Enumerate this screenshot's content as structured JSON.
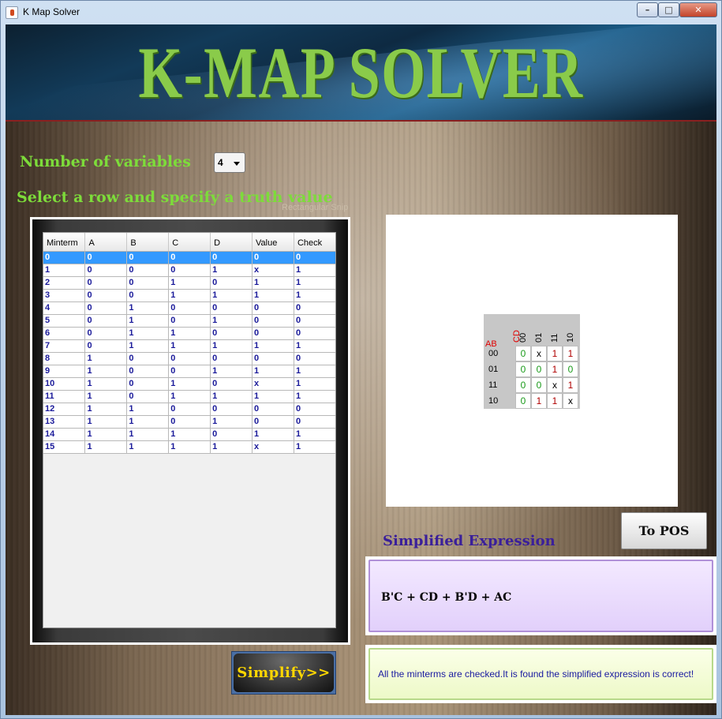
{
  "window": {
    "title": "K Map Solver"
  },
  "banner": {
    "title": "K-MAP SOLVER"
  },
  "controls": {
    "num_vars_label": "Number of variables",
    "num_vars_value": "4",
    "select_row_label": "Select a row and specify a truth value",
    "snip_text": "Rectangular Snip"
  },
  "table": {
    "columns": [
      "Minterm",
      "A",
      "B",
      "C",
      "D",
      "Value",
      "Check"
    ],
    "selected_row": 0,
    "rows": [
      [
        "0",
        "0",
        "0",
        "0",
        "0",
        "0",
        "0"
      ],
      [
        "1",
        "0",
        "0",
        "0",
        "1",
        "x",
        "1"
      ],
      [
        "2",
        "0",
        "0",
        "1",
        "0",
        "1",
        "1"
      ],
      [
        "3",
        "0",
        "0",
        "1",
        "1",
        "1",
        "1"
      ],
      [
        "4",
        "0",
        "1",
        "0",
        "0",
        "0",
        "0"
      ],
      [
        "5",
        "0",
        "1",
        "0",
        "1",
        "0",
        "0"
      ],
      [
        "6",
        "0",
        "1",
        "1",
        "0",
        "0",
        "0"
      ],
      [
        "7",
        "0",
        "1",
        "1",
        "1",
        "1",
        "1"
      ],
      [
        "8",
        "1",
        "0",
        "0",
        "0",
        "0",
        "0"
      ],
      [
        "9",
        "1",
        "0",
        "0",
        "1",
        "1",
        "1"
      ],
      [
        "10",
        "1",
        "0",
        "1",
        "0",
        "x",
        "1"
      ],
      [
        "11",
        "1",
        "0",
        "1",
        "1",
        "1",
        "1"
      ],
      [
        "12",
        "1",
        "1",
        "0",
        "0",
        "0",
        "0"
      ],
      [
        "13",
        "1",
        "1",
        "0",
        "1",
        "0",
        "0"
      ],
      [
        "14",
        "1",
        "1",
        "1",
        "0",
        "1",
        "1"
      ],
      [
        "15",
        "1",
        "1",
        "1",
        "1",
        "x",
        "1"
      ]
    ]
  },
  "kmap": {
    "row_var": "AB",
    "col_var": "CD",
    "col_labels": [
      "00",
      "01",
      "11",
      "10"
    ],
    "row_labels": [
      "00",
      "01",
      "11",
      "10"
    ],
    "cells": [
      [
        "0",
        "x",
        "1",
        "1"
      ],
      [
        "0",
        "0",
        "1",
        "0"
      ],
      [
        "0",
        "0",
        "x",
        "1"
      ],
      [
        "0",
        "1",
        "1",
        "x"
      ]
    ],
    "colors": {
      "zero": "#1a9a1a",
      "one": "#b00000",
      "dont_care": "#000000",
      "var_label": "#e00000"
    }
  },
  "actions": {
    "to_pos_label": "To POS",
    "simplify_label": "Simplify>>"
  },
  "result": {
    "label": "Simplified Expression",
    "expression": "B'C + CD + B'D + AC",
    "message": "All the minterms are checked.It is found the simplified expression is correct!"
  }
}
